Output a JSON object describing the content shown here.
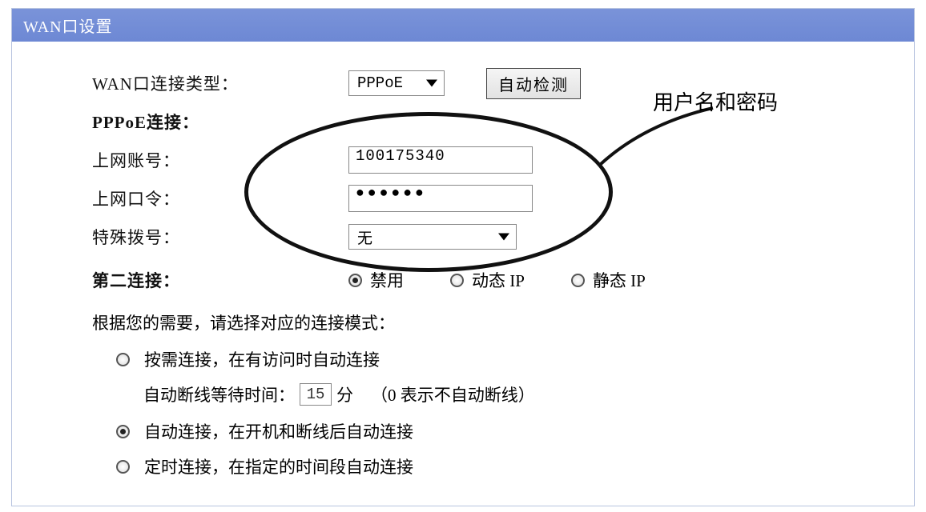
{
  "header": {
    "title": "WAN口设置"
  },
  "rows": {
    "conn_type_label": "WAN口连接类型：",
    "conn_type_value": "PPPoE",
    "auto_detect_btn": "自动检测",
    "pppoe_label": "PPPoE连接：",
    "account_label": "上网账号：",
    "account_value": "100175340",
    "password_label": "上网口令：",
    "password_mask": "●●●●●●",
    "special_dial_label": "特殊拨号：",
    "special_dial_value": "无",
    "second_conn_label": "第二连接：",
    "second_options": {
      "disable": "禁用",
      "dyn_ip": "动态 IP",
      "static_ip": "静态 IP"
    }
  },
  "modes": {
    "prompt": "根据您的需要，请选择对应的连接模式：",
    "on_demand": "按需连接，在有访问时自动连接",
    "idle_prefix": "自动断线等待时间：",
    "idle_value": "15",
    "idle_unit": "分",
    "idle_hint": "（0 表示不自动断线）",
    "auto": "自动连接，在开机和断线后自动连接",
    "scheduled": "定时连接，在指定的时间段自动连接"
  },
  "annotation": {
    "label": "用户名和密码"
  }
}
